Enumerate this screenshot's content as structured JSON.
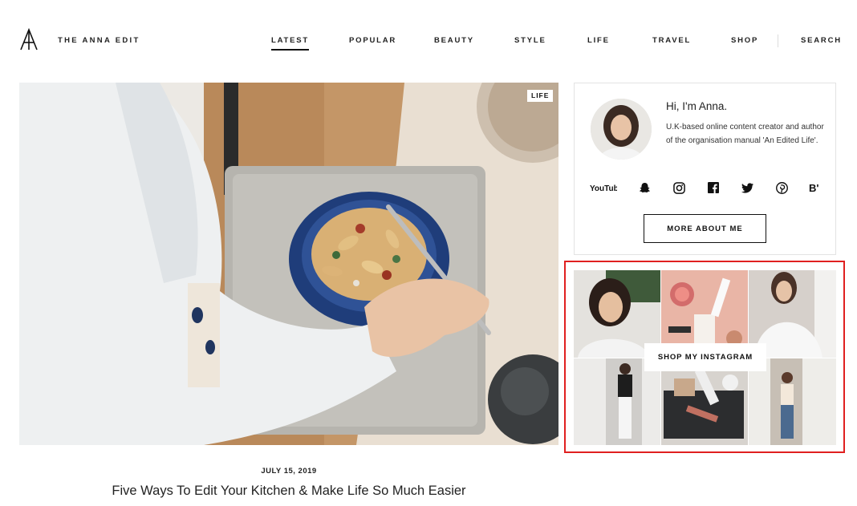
{
  "header": {
    "brand": "THE ANNA EDIT",
    "nav": [
      "LATEST",
      "POPULAR",
      "BEAUTY",
      "STYLE",
      "LIFE",
      "TRAVEL",
      "SHOP"
    ],
    "search_label": "SEARCH",
    "active_nav": "LATEST"
  },
  "featured": {
    "category_badge": "LIFE",
    "date": "JULY 15, 2019",
    "title": "Five Ways To Edit Your Kitchen & Make Life So Much Easier"
  },
  "about": {
    "greeting": "Hi, I'm Anna.",
    "bio": "U.K-based online content creator and author of the organisation manual 'An Edited Life'.",
    "socials": [
      "youtube-icon",
      "snapchat-icon",
      "instagram-icon",
      "facebook-icon",
      "twitter-icon",
      "pinterest-icon",
      "bloglovin-icon"
    ],
    "youtube_text": "YouTube",
    "bloglovin_text": "B'",
    "more_button": "MORE ABOUT ME"
  },
  "instagram": {
    "button": "SHOP MY INSTAGRAM",
    "highlight_color": "#e02020"
  }
}
